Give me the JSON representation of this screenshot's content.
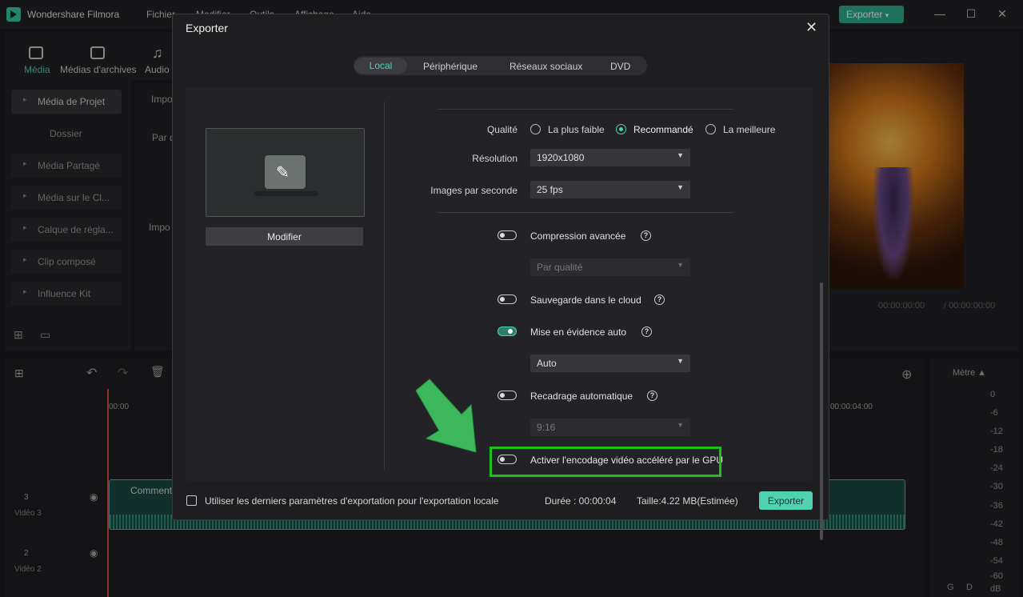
{
  "app": {
    "title": "Wondershare Filmora",
    "menu": [
      "Fichier",
      "Modifier",
      "Outils",
      "Affichage",
      "Aide"
    ],
    "export_button": "Exporter",
    "win_controls": [
      "minimize-icon",
      "maximize-icon",
      "close-icon"
    ]
  },
  "library": {
    "tabs": [
      "Média",
      "Médias d'archives",
      "Audio"
    ],
    "sidebar": [
      "Média de Projet",
      "Dossier",
      "Média Partagé",
      "Média sur le Cl...",
      "Calque de régla...",
      "Clip composé",
      "Influence Kit"
    ],
    "import_label": "Impo",
    "sort_label": "Par d",
    "import_label2": "Impo"
  },
  "preview": {
    "time_current": "00:00:00:00",
    "time_total": "/ 00:00:00:00"
  },
  "timeline": {
    "ruler_start": "00:00",
    "ruler_end": "00:00:04:00",
    "tracks": [
      {
        "num": "3",
        "label": "Vidéo 3"
      },
      {
        "num": "2",
        "label": "Vidéo 2"
      }
    ],
    "clip_title": "Comment",
    "meter_title": "Mètre ▲",
    "meter_scale": [
      "0",
      "-6",
      "-12",
      "-18",
      "-24",
      "-30",
      "-36",
      "-42",
      "-48",
      "-54",
      "-60",
      "dB"
    ],
    "meter_channels": [
      "G",
      "D"
    ]
  },
  "dialog": {
    "title": "Exporter",
    "tabs": [
      "Local",
      "Périphérique",
      "Réseaux sociaux",
      "DVD"
    ],
    "active_tab": "Local",
    "modify_button": "Modifier",
    "quality_label": "Qualité",
    "quality_options": [
      "La plus faible",
      "Recommandé",
      "La meilleure"
    ],
    "quality_selected": "Recommandé",
    "resolution_label": "Résolution",
    "resolution_value": "1920x1080",
    "fps_label": "Images par seconde",
    "fps_value": "25 fps",
    "advanced_compression": {
      "label": "Compression avancée",
      "enabled": false,
      "select": "Par qualité"
    },
    "cloud_backup": {
      "label": "Sauvegarde dans le cloud",
      "enabled": false
    },
    "auto_highlight": {
      "label": "Mise en évidence auto",
      "enabled": true,
      "select": "Auto"
    },
    "auto_reframe": {
      "label": "Recadrage automatique",
      "enabled": false,
      "select": "9:16"
    },
    "gpu_encoding": {
      "label": "Activer l'encodage vidéo accéléré par le GPU",
      "enabled": false
    },
    "use_last_settings": "Utiliser les derniers paramètres d'exportation pour l'exportation locale",
    "duration": "Durée : 00:00:04",
    "size": "Taille:4.22 MB(Estimée)",
    "export_button": "Exporter",
    "accent_color": "#4fd2b2",
    "highlight_color": "#1cc11c"
  }
}
